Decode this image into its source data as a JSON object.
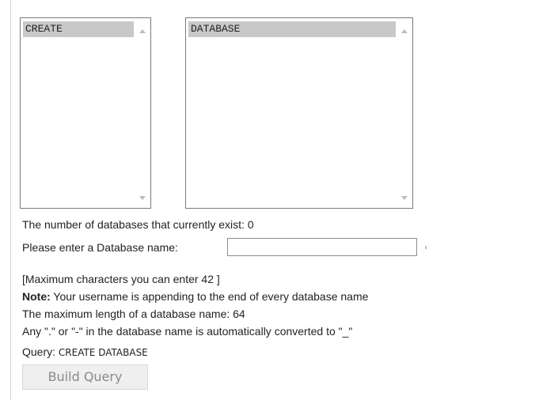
{
  "lists": {
    "create_option": "CREATE",
    "database_option": "DATABASE"
  },
  "info": {
    "db_count_text": "The number of databases that currently exist: 0",
    "enter_name_label": "Please enter a Database name:",
    "max_chars_text": "[Maximum characters you can enter 42 ]",
    "note_label": "Note:",
    "note_text": " Your username is appending to the end of every database name",
    "max_length_text": "The maximum length of a database name: 64",
    "convert_text": "Any \".\" or \"-\" in the database name is automatically converted to \"_\"",
    "query_label": "Query: ",
    "query_value": "CREATE DATABASE"
  },
  "input": {
    "value": "",
    "placeholder": ""
  },
  "buttons": {
    "build_query": "Build Query"
  },
  "colors": {
    "selected_option_bg": "#c8c8c8",
    "divider": "#c9d6e3",
    "button_text_disabled": "#8a8a8a"
  }
}
